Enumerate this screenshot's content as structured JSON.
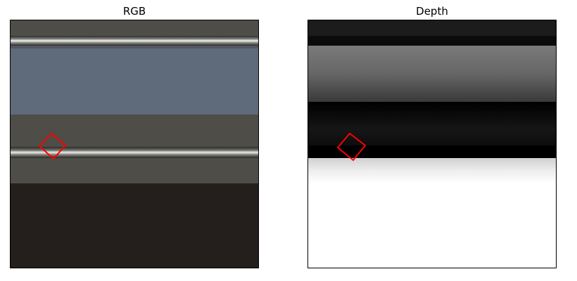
{
  "panels": {
    "rgb": {
      "title": "RGB"
    },
    "depth": {
      "title": "Depth"
    }
  },
  "colors": {
    "marker": "#ff0000",
    "frame": "#000000",
    "background": "#ffffff"
  }
}
